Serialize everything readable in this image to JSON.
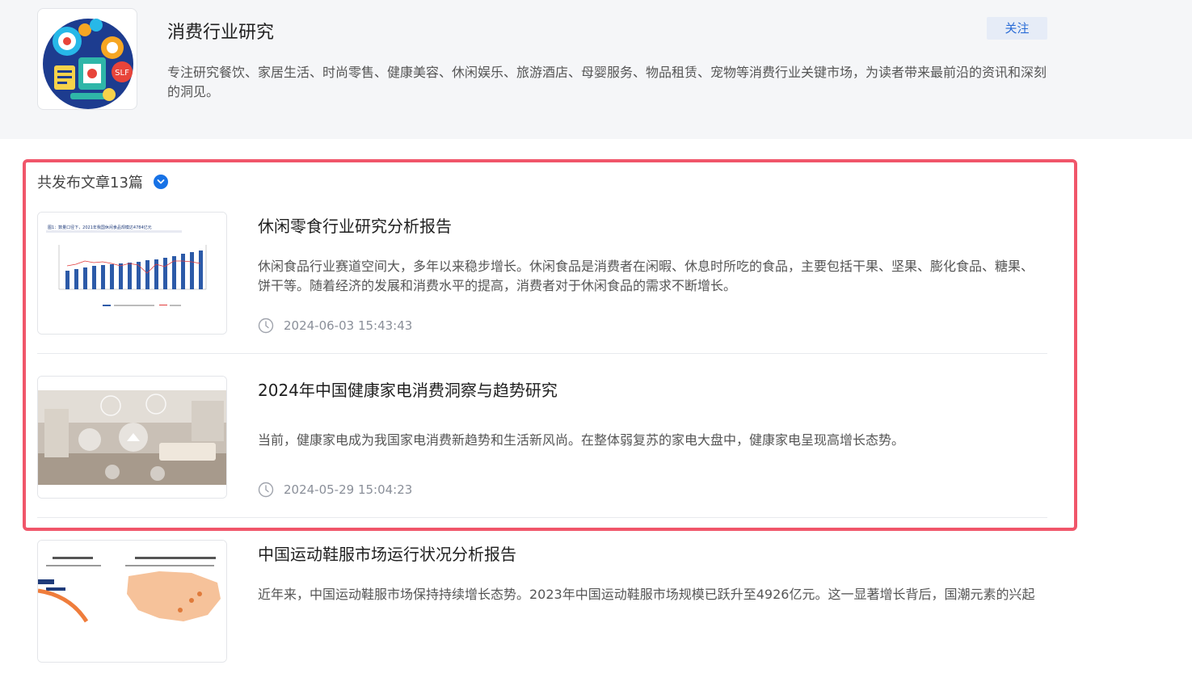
{
  "header": {
    "title": "消费行业研究",
    "description": "专注研究餐饮、家居生活、时尚零售、健康美容、休闲娱乐、旅游酒店、母婴服务、物品租赁、宠物等消费行业关键市场，为读者带来最前沿的资讯和深刻的洞见。",
    "follow_label": "关注",
    "logo_text": "SLF"
  },
  "list": {
    "count_text": "共发布文章13篇"
  },
  "articles": [
    {
      "title": "休闲零食行业研究分析报告",
      "summary": "休闲食品行业赛道空间大，多年以来稳步增长。休闲食品是消费者在闲暇、休息时所吃的食品，主要包括干果、坚果、膨化食品、糖果、饼干等。随着经济的发展和消费水平的提高，消费者对于休闲食品的需求不断增长。",
      "time": "2024-06-03 15:43:43",
      "thumb_caption": "图1：数量口径下，2021年我国休闲食品规模达4784亿元"
    },
    {
      "title": "2024年中国健康家电消费洞察与趋势研究",
      "summary": "当前，健康家电成为我国家电消费新趋势和生活新风尚。在整体弱复苏的家电大盘中，健康家电呈现高增长态势。",
      "time": "2024-05-29 15:04:23"
    },
    {
      "title": "中国运动鞋服市场运行状况分析报告",
      "summary": "近年来，中国运动鞋服市场保持持续增长态势。2023年中国运动鞋服市场规模已跃升至4926亿元。这一显著增长背后，国潮元素的兴起",
      "time": ""
    }
  ],
  "colors": {
    "accent": "#1772e6",
    "highlight": "#f0566a",
    "header_bg": "#f5f6f8"
  }
}
